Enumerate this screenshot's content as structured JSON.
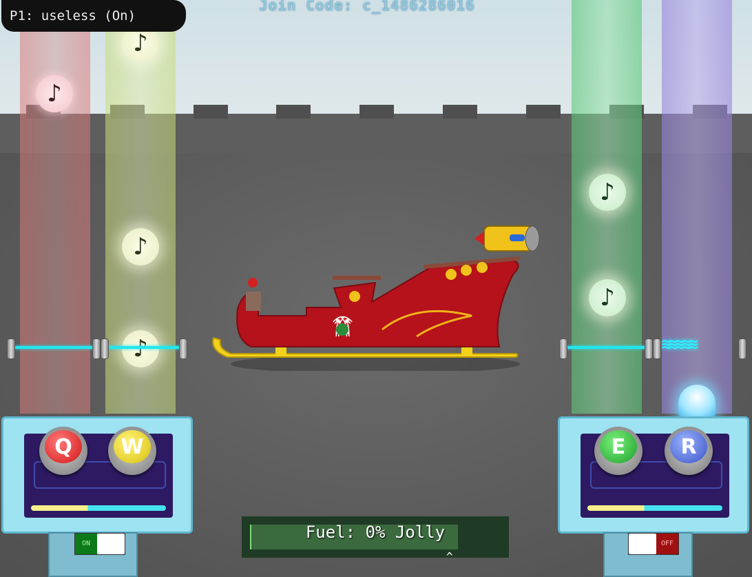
{
  "hud": {
    "player_label": "P1: useless (On)",
    "join_code": "Join Code: c_1486286016",
    "fuel_text": "Fuel: 0% Jolly",
    "caret": "^"
  },
  "lanes": [
    {
      "name": "red",
      "key": "Q",
      "color": "#d21414"
    },
    {
      "name": "yellow",
      "key": "W",
      "color": "#d9c20a"
    },
    {
      "name": "green",
      "key": "E",
      "color": "#1c9f2a"
    },
    {
      "name": "purple",
      "key": "R",
      "color": "#3a54c4"
    }
  ],
  "note_glyph": "♪",
  "toggles": {
    "left": {
      "label": "ON",
      "color": "#0d7a1a"
    },
    "right": {
      "label": "OFF",
      "color": "#a01010"
    }
  },
  "zap_glyph": "≋≋≋≋≋"
}
